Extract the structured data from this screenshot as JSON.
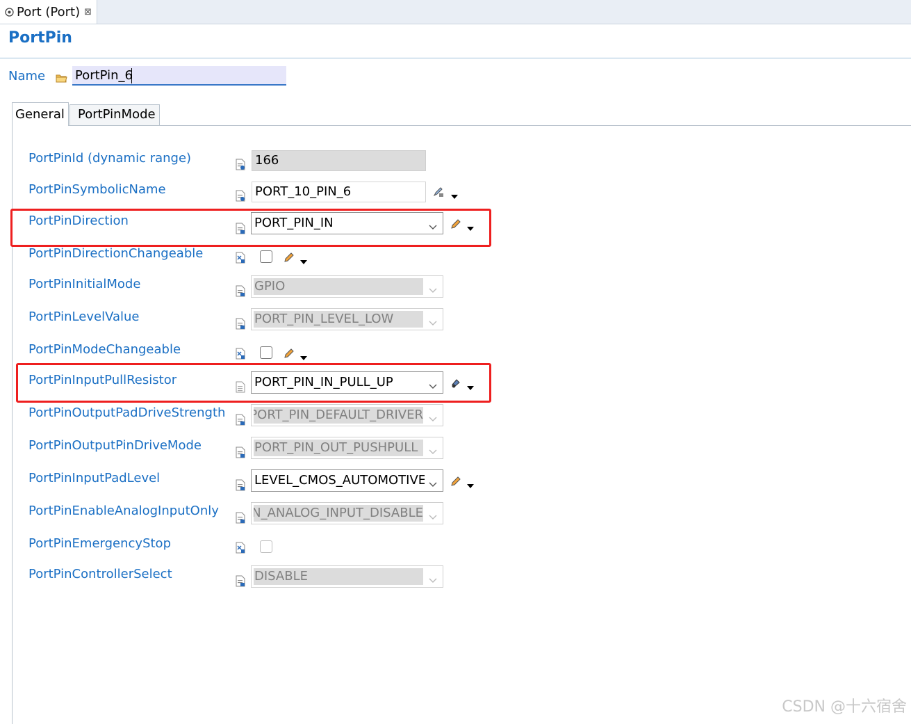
{
  "editor_tab": {
    "title": "Port (Port)",
    "close": "⊠"
  },
  "page_title": "PortPin",
  "name_field": {
    "label": "Name",
    "value": "PortPin_6"
  },
  "inner_tabs": [
    {
      "label": "General"
    },
    {
      "label": "PortPinMode"
    }
  ],
  "params": {
    "pin_id": {
      "label": "PortPinId (dynamic range)",
      "value": "166"
    },
    "symbolic_name": {
      "label": "PortPinSymbolicName",
      "value": "PORT_10_PIN_6"
    },
    "direction": {
      "label": "PortPinDirection",
      "value": "PORT_PIN_IN"
    },
    "direction_changeable": {
      "label": "PortPinDirectionChangeable",
      "checked": false
    },
    "initial_mode": {
      "label": "PortPinInitialMode",
      "value": "GPIO"
    },
    "level_value": {
      "label": "PortPinLevelValue",
      "value": "PORT_PIN_LEVEL_LOW"
    },
    "mode_changeable": {
      "label": "PortPinModeChangeable",
      "checked": false
    },
    "input_pull": {
      "label": "PortPinInputPullResistor",
      "value": "PORT_PIN_IN_PULL_UP"
    },
    "pad_drive": {
      "label": "PortPinOutputPadDriveStrength",
      "value": "PORT_PIN_DEFAULT_DRIVER"
    },
    "out_drive_mode": {
      "label": "PortPinOutputPinDriveMode",
      "value": "PORT_PIN_OUT_PUSHPULL"
    },
    "input_pad_level": {
      "label": "PortPinInputPadLevel",
      "value": "LEVEL_CMOS_AUTOMOTIVE"
    },
    "analog_only": {
      "label": "PortPinEnableAnalogInputOnly",
      "value": "PORT_PIN_ANALOG_INPUT_DISABLE"
    },
    "emergency_stop": {
      "label": "PortPinEmergencyStop",
      "checked": false
    },
    "controller_select": {
      "label": "PortPinControllerSelect",
      "value": "DISABLE"
    }
  },
  "highlight_color": "#ee1f1f",
  "accent_color": "#1a6fc4",
  "watermark": "CSDN @十六宿舍"
}
